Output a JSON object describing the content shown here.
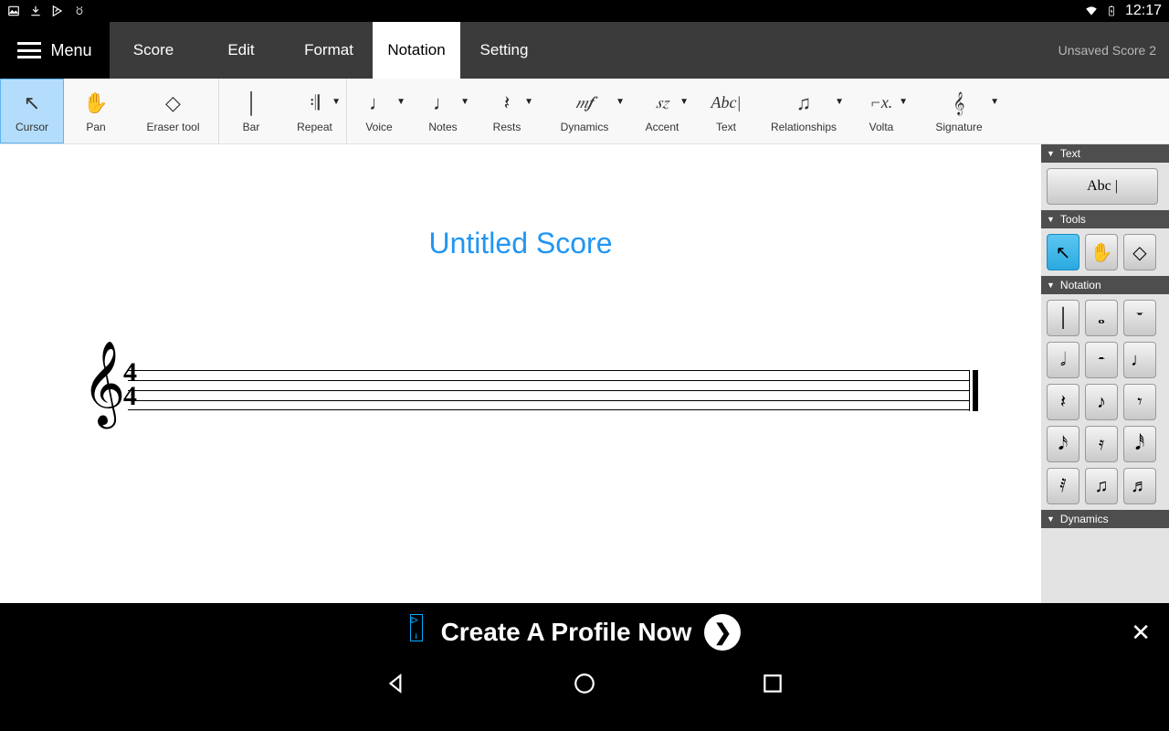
{
  "status": {
    "time": "12:17"
  },
  "menu": {
    "menu_label": "Menu",
    "tabs": [
      "Score",
      "Edit",
      "Format",
      "Notation",
      "Setting"
    ],
    "active_tab": "Notation",
    "document_title": "Unsaved Score 2"
  },
  "toolbar": {
    "items": [
      {
        "label": "Cursor",
        "icon": "↖",
        "selected": true,
        "dropdown": false
      },
      {
        "label": "Pan",
        "icon": "✋",
        "selected": false,
        "dropdown": false
      },
      {
        "label": "Eraser tool",
        "icon": "◇",
        "selected": false,
        "dropdown": false
      },
      {
        "label": "Bar",
        "icon": "│",
        "selected": false,
        "dropdown": false
      },
      {
        "label": "Repeat",
        "icon": "𝄇",
        "selected": false,
        "dropdown": true
      },
      {
        "label": "Voice",
        "icon": "♩",
        "selected": false,
        "dropdown": true
      },
      {
        "label": "Notes",
        "icon": "♩",
        "selected": false,
        "dropdown": true
      },
      {
        "label": "Rests",
        "icon": "𝄽",
        "selected": false,
        "dropdown": true
      },
      {
        "label": "Dynamics",
        "icon": "𝆐𝆑",
        "selected": false,
        "dropdown": true
      },
      {
        "label": "Accent",
        "icon": "𝆍𝆎",
        "selected": false,
        "dropdown": true
      },
      {
        "label": "Text",
        "icon": "Abc|",
        "selected": false,
        "dropdown": false
      },
      {
        "label": "Relationships",
        "icon": "♫",
        "selected": false,
        "dropdown": true
      },
      {
        "label": "Volta",
        "icon": "⌐x.",
        "selected": false,
        "dropdown": true
      },
      {
        "label": "Signature",
        "icon": "𝄞",
        "selected": false,
        "dropdown": true
      }
    ]
  },
  "score": {
    "title": "Untitled Score",
    "clef": "𝄞",
    "time_top": "4",
    "time_bottom": "4"
  },
  "side": {
    "sections": {
      "text": {
        "title": "Text",
        "buttons": [
          {
            "label": "Abc |",
            "wide": true
          }
        ]
      },
      "tools": {
        "title": "Tools",
        "buttons": [
          {
            "label": "↖",
            "selected": true
          },
          {
            "label": "✋"
          },
          {
            "label": "◇"
          }
        ]
      },
      "notation": {
        "title": "Notation",
        "buttons": [
          {
            "label": "│"
          },
          {
            "label": "𝅝"
          },
          {
            "label": "𝄻"
          },
          {
            "label": "𝅗𝅥"
          },
          {
            "label": "𝄼"
          },
          {
            "label": "♩"
          },
          {
            "label": "𝄽"
          },
          {
            "label": "♪"
          },
          {
            "label": "𝄾"
          },
          {
            "label": "𝅘𝅥𝅯"
          },
          {
            "label": "𝄿"
          },
          {
            "label": "𝅘𝅥𝅰"
          },
          {
            "label": "𝅀"
          },
          {
            "label": "♫"
          },
          {
            "label": "♬"
          }
        ]
      },
      "dynamics": {
        "title": "Dynamics"
      }
    }
  },
  "ad": {
    "text": "Create A Profile Now"
  },
  "colors": {
    "accent": "#2196f3",
    "tab_bg": "#3b3b3b"
  }
}
